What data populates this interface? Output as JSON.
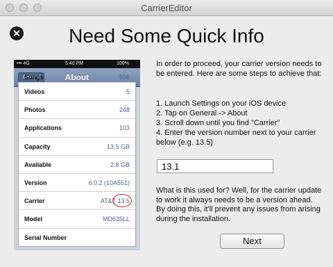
{
  "window": {
    "title": "CarrierEditor"
  },
  "heading": "Need Some Quick Info",
  "phone": {
    "status": {
      "carrier": "••• 4G",
      "time": "5:40 PM",
      "battery": "100%"
    },
    "nav": {
      "back": "General",
      "title": "About"
    },
    "rows": [
      {
        "label": "Songs",
        "value": "506"
      },
      {
        "label": "Videos",
        "value": "5"
      },
      {
        "label": "Photos",
        "value": "248"
      },
      {
        "label": "Applications",
        "value": "103"
      },
      {
        "label": "Capacity",
        "value": "13.5 GB"
      },
      {
        "label": "Available",
        "value": "2.8 GB"
      },
      {
        "label": "Version",
        "value": "6.0.2 (10A551)"
      },
      {
        "label": "Carrier",
        "value": "AT&T 13.5"
      },
      {
        "label": "Model",
        "value": "MD635LL"
      },
      {
        "label": "Serial Number",
        "value": ""
      }
    ]
  },
  "instructions": {
    "intro": "In order to proceed, your carrier version needs to be entered. Here are some steps to achieve that:",
    "steps": [
      "1. Launch Settings on your iOS device",
      "2. Tap on General -> About",
      "3. Scroll down until you find \"Carrier\"",
      "4. Enter the version number next to your carrier below (e.g. 13.5)"
    ]
  },
  "version_input": {
    "value": "13.1"
  },
  "explanation": "What is this used for? Well, for the carrier update to work it always needs to be a version ahead. By doing this, it'll prevent any issues from arising during the installation.",
  "next_button": {
    "label": "Next"
  }
}
